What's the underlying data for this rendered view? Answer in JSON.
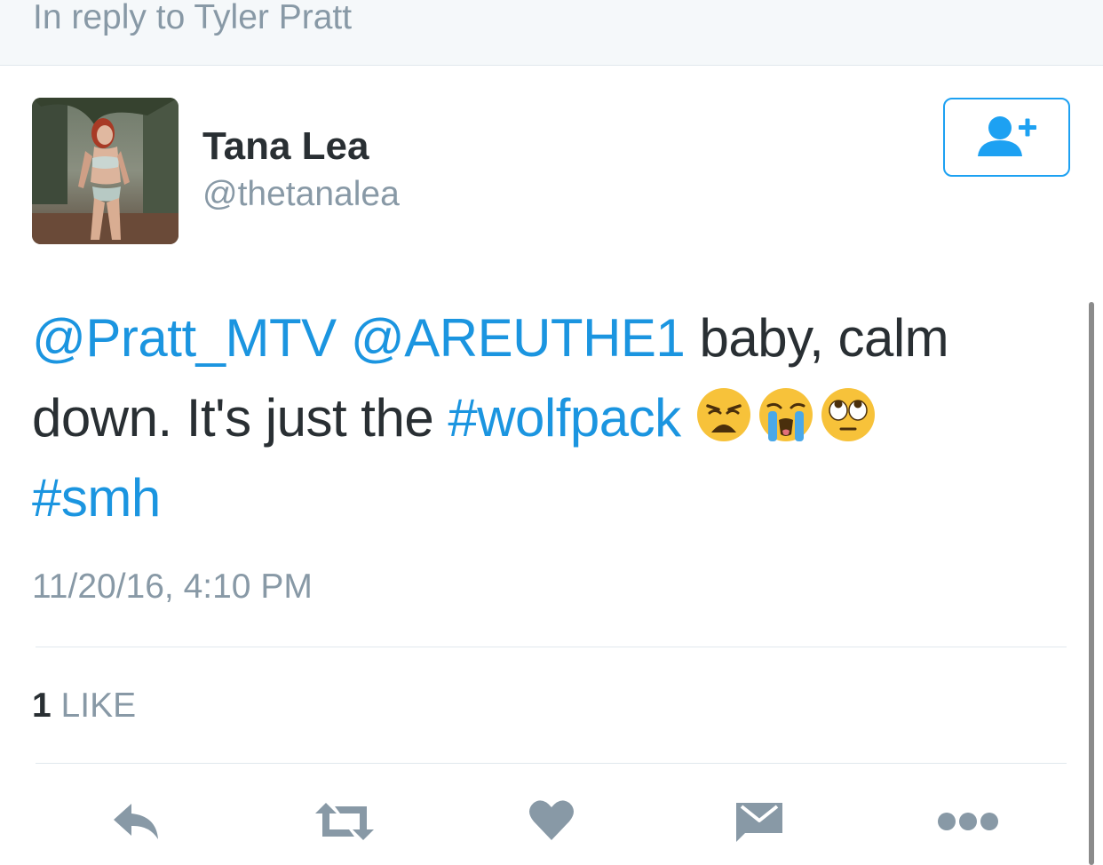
{
  "header": {
    "reply_context": "In reply to Tyler Pratt"
  },
  "author": {
    "display_name": "Tana Lea",
    "username": "@thetanalea",
    "avatar_icon": "profile-photo"
  },
  "follow_button": {
    "icon": "add-user-icon",
    "color": "#1da1f2"
  },
  "tweet": {
    "segments": [
      {
        "text": "@Pratt_MTV",
        "type": "mention"
      },
      {
        "text": " ",
        "type": "text"
      },
      {
        "text": "@AREUTHE1",
        "type": "mention"
      },
      {
        "text": " baby, calm down. It's just the ",
        "type": "text"
      },
      {
        "text": "#wolfpack",
        "type": "hashtag"
      },
      {
        "text": " ",
        "type": "text"
      }
    ],
    "emojis": [
      "weary-face-emoji",
      "loudly-crying-face-emoji",
      "face-with-rolling-eyes-emoji"
    ],
    "trailing_hashtag": "#smh",
    "timestamp": "11/20/16, 4:10 PM"
  },
  "stats": {
    "like_count": "1",
    "like_label": "LIKE"
  },
  "actions": [
    {
      "name": "reply",
      "icon": "reply-icon"
    },
    {
      "name": "retweet",
      "icon": "retweet-icon"
    },
    {
      "name": "like",
      "icon": "heart-icon"
    },
    {
      "name": "direct-message",
      "icon": "envelope-icon"
    },
    {
      "name": "more",
      "icon": "more-dots-icon"
    }
  ],
  "colors": {
    "link": "#1b95e0",
    "secondary_text": "#8899a6",
    "primary_text": "#292f33",
    "action_icon": "#8899a6"
  }
}
